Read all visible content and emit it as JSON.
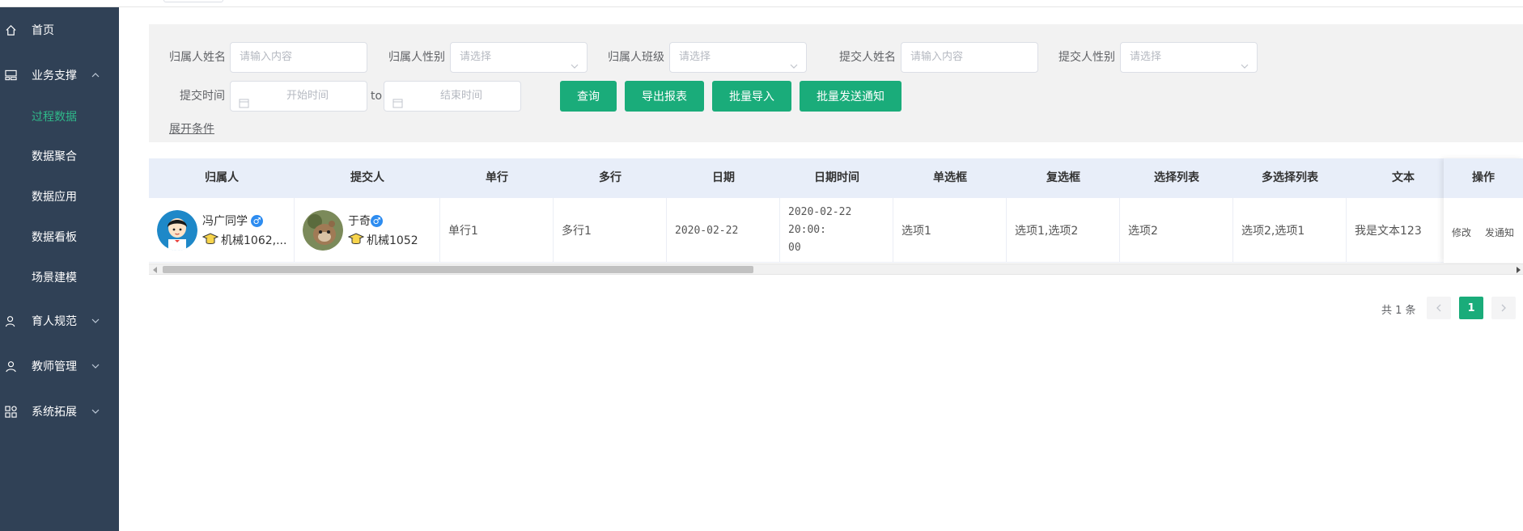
{
  "sidebar": {
    "items": [
      {
        "label": "首页",
        "icon": "home-icon"
      },
      {
        "label": "业务支撑",
        "icon": "dashboard-icon",
        "expanded": true
      },
      {
        "label": "育人规范",
        "icon": "user-icon",
        "expanded": false
      },
      {
        "label": "教师管理",
        "icon": "teacher-icon",
        "expanded": false
      },
      {
        "label": "系统拓展",
        "icon": "apps-icon",
        "expanded": false
      }
    ],
    "subitems": [
      {
        "label": "过程数据",
        "active": true
      },
      {
        "label": "数据聚合"
      },
      {
        "label": "数据应用"
      },
      {
        "label": "数据看板"
      },
      {
        "label": "场景建模"
      }
    ]
  },
  "filter": {
    "owner_name_label": "归属人姓名",
    "owner_name_placeholder": "请输入内容",
    "owner_gender_label": "归属人性别",
    "owner_gender_placeholder": "请选择",
    "owner_class_label": "归属人班级",
    "owner_class_placeholder": "请选择",
    "submitter_name_label": "提交人姓名",
    "submitter_name_placeholder": "请输入内容",
    "submitter_gender_label": "提交人性别",
    "submitter_gender_placeholder": "请选择",
    "submit_time_label": "提交时间",
    "start_time_placeholder": "开始时间",
    "to_label": "to",
    "end_time_placeholder": "结束时间",
    "expand_label": "展开条件"
  },
  "buttons": {
    "query": "查询",
    "export": "导出报表",
    "import": "批量导入",
    "notify": "批量发送通知"
  },
  "table": {
    "headers": [
      "归属人",
      "提交人",
      "单行",
      "多行",
      "日期",
      "日期时间",
      "单选框",
      "复选框",
      "选择列表",
      "多选择列表",
      "文本",
      "操作"
    ],
    "rows": [
      {
        "owner_name": "冯广同学",
        "owner_gender": "♂",
        "owner_class": "机械1062,...",
        "submitter_name": "于奇",
        "submitter_gender": "♂",
        "submitter_class": "机械1052",
        "single": "单行1",
        "multi": "多行1",
        "date": "2020-02-22",
        "datetime_line1": "2020-02-22 20:00:",
        "datetime_line2": "00",
        "radio": "选项1",
        "checkbox": "选项1,选项2",
        "select": "选项2",
        "multiselect": "选项2,选项1",
        "text": "我是文本123",
        "op_edit": "修改",
        "op_notify": "发通知"
      }
    ]
  },
  "pagination": {
    "total": "共 1 条",
    "current": "1"
  },
  "colors": {
    "sidebar_bg": "#304156",
    "active_menu": "#2fb98a",
    "primary_button": "#1aac7a",
    "table_header_bg": "#e8eef9"
  }
}
